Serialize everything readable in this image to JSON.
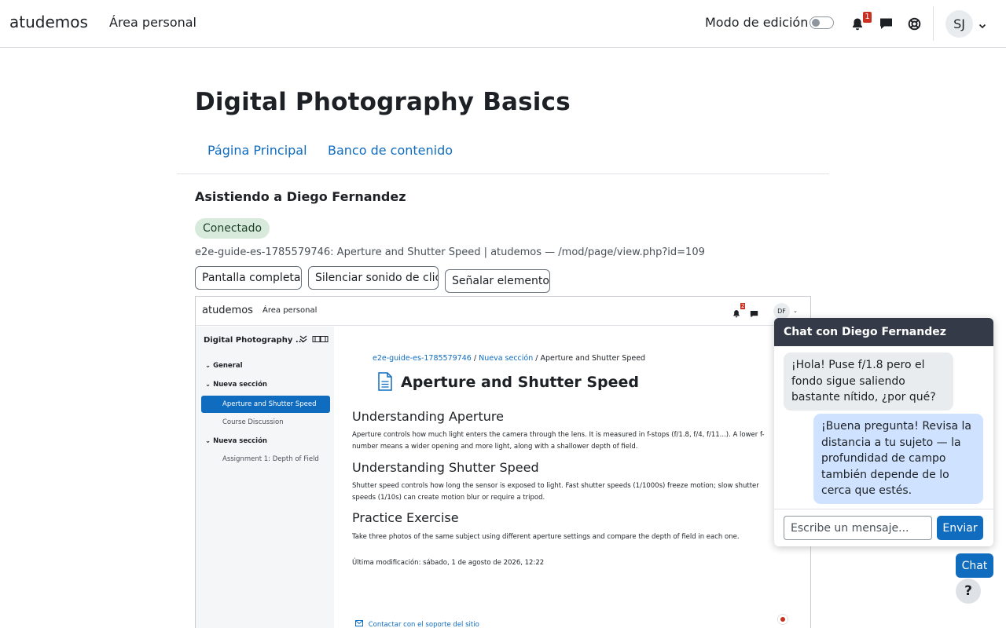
{
  "navbar": {
    "brand": "atudemos",
    "link": "Área personal",
    "edit_mode_label": "Modo de edición",
    "notification_count": "1",
    "avatar_initials": "SJ",
    "icons": [
      "bell-icon",
      "chat-bubble-icon",
      "lifebuoy-icon",
      "chevron-down-icon"
    ]
  },
  "page": {
    "title": "Digital Photography Basics",
    "tabs": [
      "Página Principal",
      "Banco de contenido"
    ],
    "assist_title": "Asistiendo a Diego Fernandez",
    "status": "Conectado",
    "url_line": "e2e-guide-es-1785579746: Aperture and Shutter Speed | atudemos — /mod/page/view.php?id=109",
    "buttons": {
      "fullscreen": "Pantalla completa",
      "mute": "Silenciar sonido de clic",
      "point": "Señalar elemento"
    }
  },
  "frame": {
    "brand": "atudemos",
    "link": "Área personal",
    "notification_count": "2",
    "avatar_initials": "DF",
    "drawer": {
      "title": "Digital Photography ...",
      "sections": [
        "General",
        "Nueva sección",
        "Nueva sección"
      ],
      "items": [
        "Aperture and Shutter Speed",
        "Course Discussion",
        "Assignment 1: Depth of Field"
      ]
    },
    "breadcrumb": [
      "e2e-guide-es-1785579746",
      "Nueva sección",
      "Aperture and Shutter Speed"
    ],
    "page_title": "Aperture and Shutter Speed",
    "blocks": [
      {
        "heading": "Understanding Aperture",
        "text": "Aperture controls how much light enters the camera through the lens. It is measured in f-stops (f/1.8, f/4, f/11...). A lower f-number means a wider opening and more light, along with a shallower depth of field."
      },
      {
        "heading": "Understanding Shutter Speed",
        "text": "Shutter speed controls how long the sensor is exposed to light. Fast shutter speeds (1/1000s) freeze motion; slow shutter speeds (1/10s) can create motion blur or require a tripod."
      },
      {
        "heading": "Practice Exercise",
        "text": "Take three photos of the same subject using different aperture settings and compare the depth of field in each one."
      }
    ],
    "last_modified": "Última modificación: sábado, 1 de agosto de 2026, 12:22",
    "support_link": "Contactar con el soporte del sitio"
  },
  "chat": {
    "title": "Chat con Diego Fernandez",
    "messages": [
      {
        "from": "Diego Fernandez",
        "text": "¡Hola! Puse f/1.8 pero el fondo sigue saliendo bastante nítido, ¿por qué?"
      },
      {
        "from": "SJ",
        "text": "¡Buena pregunta! Revisa la distancia a tu sujeto — la profundidad de campo también depende de lo cerca que estés."
      }
    ],
    "input_placeholder": "Escribe un mensaje...",
    "send_label": "Enviar",
    "fab_label": "Chat",
    "help_label": "?"
  },
  "colors": {
    "primary": "#0f6cbf",
    "chat_header": "#343a48",
    "status_bg": "#d7eadb",
    "badge": "#ca3120"
  }
}
